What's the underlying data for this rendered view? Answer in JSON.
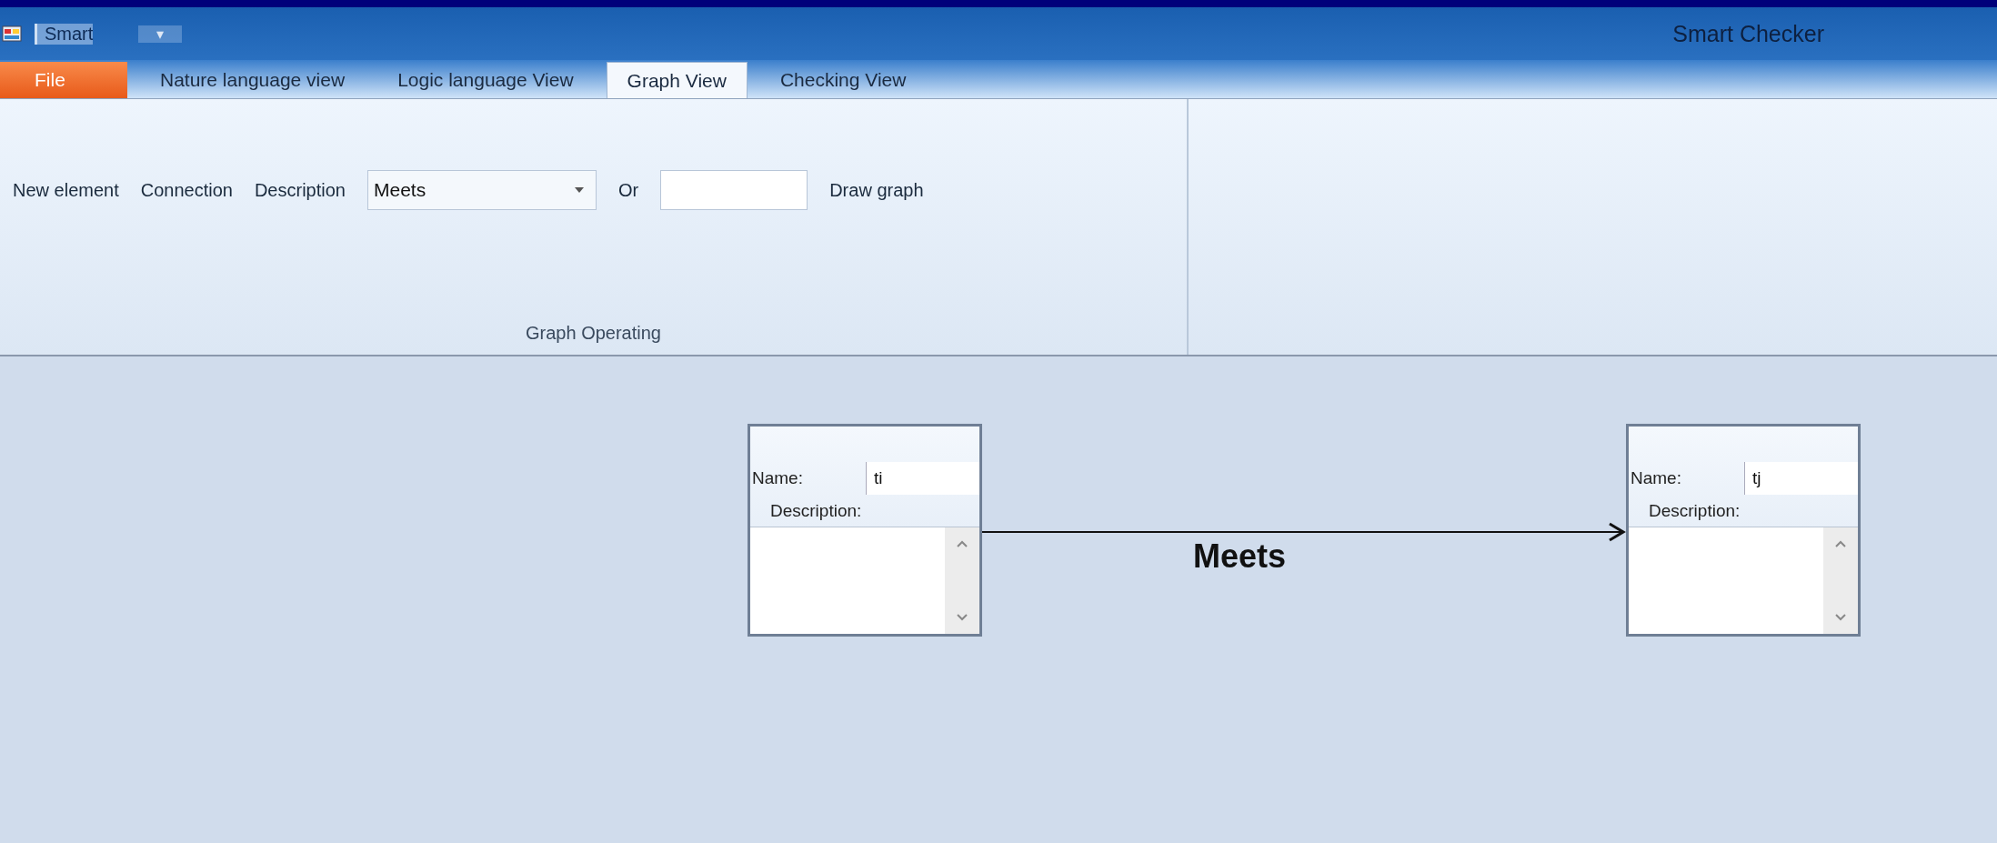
{
  "window": {
    "title": "Smart Checker",
    "quick_access": "Smart",
    "quick_access_menu": "▾"
  },
  "tabs": [
    {
      "label": "File",
      "kind": "file"
    },
    {
      "label": "Nature language view",
      "kind": "tab",
      "selected": false
    },
    {
      "label": "Logic language View",
      "kind": "tab",
      "selected": false
    },
    {
      "label": "Graph View",
      "kind": "tab",
      "selected": true
    },
    {
      "label": "Checking View",
      "kind": "tab",
      "selected": false
    }
  ],
  "ribbon": {
    "controls": [
      {
        "kind": "button",
        "label": "New element"
      },
      {
        "kind": "button",
        "label": "Connection"
      },
      {
        "kind": "label",
        "label": "Description"
      },
      {
        "kind": "combo",
        "value": "Meets"
      },
      {
        "kind": "label",
        "label": "Or"
      },
      {
        "kind": "input"
      },
      {
        "kind": "button",
        "label": "Draw graph"
      }
    ],
    "group_label": "Graph Operating"
  },
  "graph": {
    "nodes": [
      {
        "name_label": "Name:",
        "name": "ti",
        "description_label": "Description:"
      },
      {
        "name_label": "Name:",
        "name": "tj",
        "description_label": "Description:"
      }
    ],
    "edges": [
      {
        "label": "Meets"
      }
    ]
  }
}
